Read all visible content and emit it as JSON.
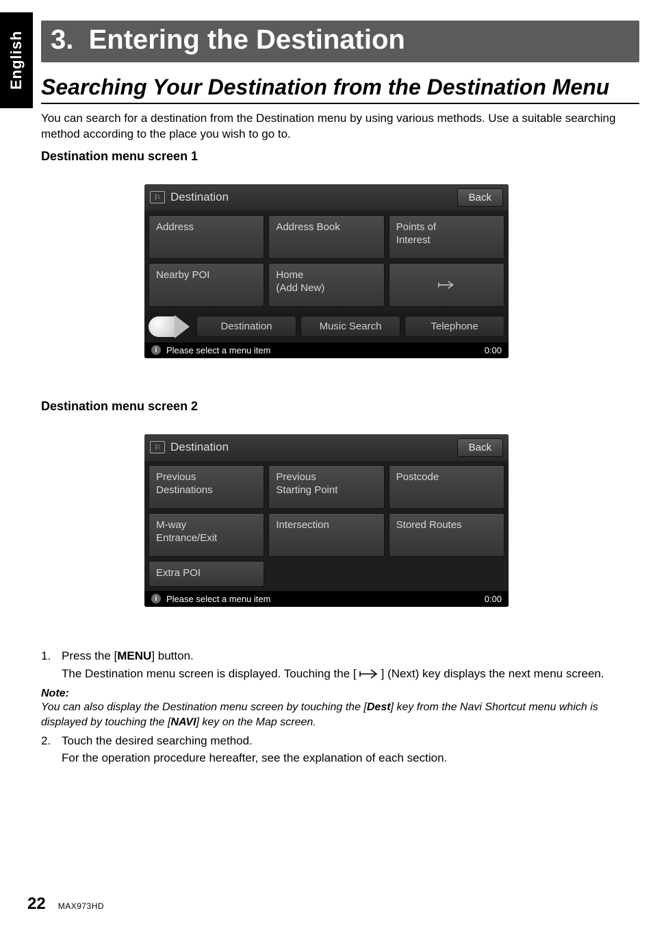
{
  "language_tab": "English",
  "chapter": {
    "number": "3.",
    "title": "Entering the Destination"
  },
  "section_title": "Searching Your Destination from the Destination Menu",
  "intro": "You can search for a destination from the Destination menu by using various methods. Use a suitable searching method according to the place you wish to go to.",
  "screen1": {
    "caption": "Destination menu screen 1",
    "title": "Destination",
    "back": "Back",
    "tiles": [
      "Address",
      "Address Book",
      "Points of\nInterest",
      "Nearby POI",
      "Home\n(Add New)",
      ""
    ],
    "tabs": [
      "Destination",
      "Music Search",
      "Telephone"
    ],
    "status": "Please select a menu item",
    "time": "0:00"
  },
  "screen2": {
    "caption": "Destination menu screen 2",
    "title": "Destination",
    "back": "Back",
    "tiles": [
      "Previous\nDestinations",
      "Previous\nStarting Point",
      "Postcode",
      "M-way\nEntrance/Exit",
      "Intersection",
      "Stored Routes"
    ],
    "extra": "Extra POI",
    "status": "Please select a menu item",
    "time": "0:00"
  },
  "steps": {
    "s1_pre": "Press the [",
    "s1_btn": "MENU",
    "s1_post": "] button.",
    "s1_cont_a": "The Destination menu screen is displayed. Touching the [",
    "s1_cont_b": "] (Next) key displays the next menu screen.",
    "note_head": "Note:",
    "note_body_a": "You can also display the Destination menu screen by touching the [",
    "note_bold_1": "Dest",
    "note_body_b": "] key from the Navi Shortcut menu which is displayed by touching the [",
    "note_bold_2": "NAVI",
    "note_body_c": "] key on the Map screen.",
    "s2": "Touch the desired searching method.",
    "s2_cont": "For the operation procedure hereafter, see the explanation of each section."
  },
  "footer": {
    "page": "22",
    "model": "MAX973HD"
  }
}
